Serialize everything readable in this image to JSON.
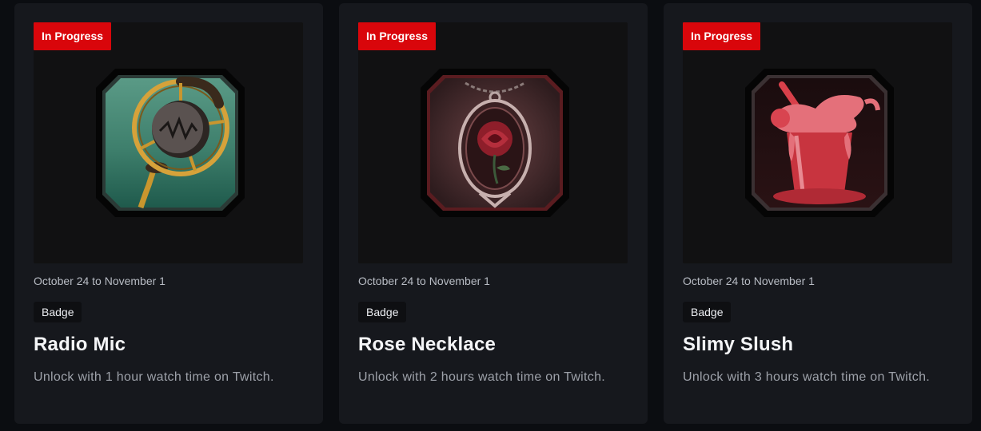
{
  "cards": [
    {
      "status": "In Progress",
      "dates": "October 24 to November 1",
      "tag": "Badge",
      "name": "Radio Mic",
      "description": "Unlock with 1 hour watch time on Twitch.",
      "art_icon": "radio-mic-badge-art"
    },
    {
      "status": "In Progress",
      "dates": "October 24 to November 1",
      "tag": "Badge",
      "name": "Rose Necklace",
      "description": "Unlock with 2 hours watch time on Twitch.",
      "art_icon": "rose-necklace-badge-art"
    },
    {
      "status": "In Progress",
      "dates": "October 24 to November 1",
      "tag": "Badge",
      "name": "Slimy Slush",
      "description": "Unlock with 3 hours watch time on Twitch.",
      "art_icon": "slimy-slush-badge-art"
    }
  ],
  "colors": {
    "page_background": "#0b0d11",
    "card_background": "#16181d",
    "status_badge": "#d9060b",
    "title_text": "#f4f5f7",
    "body_text": "#9da1a9"
  }
}
